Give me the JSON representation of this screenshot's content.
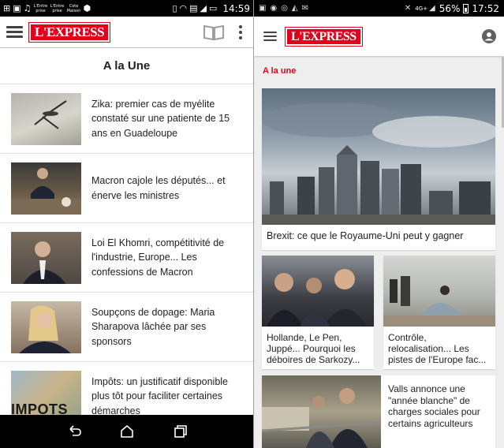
{
  "left": {
    "status": {
      "tiny_labels": [
        "L'Entre prise",
        "L'Entre prise",
        "Cote Maison"
      ],
      "time": "14:59"
    },
    "section_title": "A la Une",
    "articles": [
      {
        "title": "Zika: premier cas de myélite constaté sur une patiente de 15 ans en Guadeloupe"
      },
      {
        "title": "Macron cajole les députés... et énerve les ministres"
      },
      {
        "title": "Loi El Khomri, compétitivité de l'industrie, Europe... Les confessions de Macron"
      },
      {
        "title": "Soupçons de dopage: Maria Sharapova lâchée par ses sponsors"
      },
      {
        "title": "Impôts: un justificatif disponible plus tôt pour faciliter certaines démarches",
        "thumb_text": "IMPOTS"
      }
    ]
  },
  "right": {
    "status": {
      "network": "4G+",
      "battery": "56%",
      "time": "17:52"
    },
    "section_title": "A la une",
    "hero": {
      "caption": "Brexit: ce que le Royaume-Uni peut y gagner"
    },
    "cards": [
      {
        "caption": "Hollande, Le Pen, Juppé... Pourquoi les déboires de Sarkozy..."
      },
      {
        "caption": "Contrôle, relocalisation... Les pistes de l'Europe fac..."
      },
      {
        "caption": "Valls annonce une \"année blanche\" de charges sociales pour certains agriculteurs"
      }
    ]
  },
  "brand": {
    "logo": "L'EXPRESS",
    "accent": "#e2001a"
  }
}
